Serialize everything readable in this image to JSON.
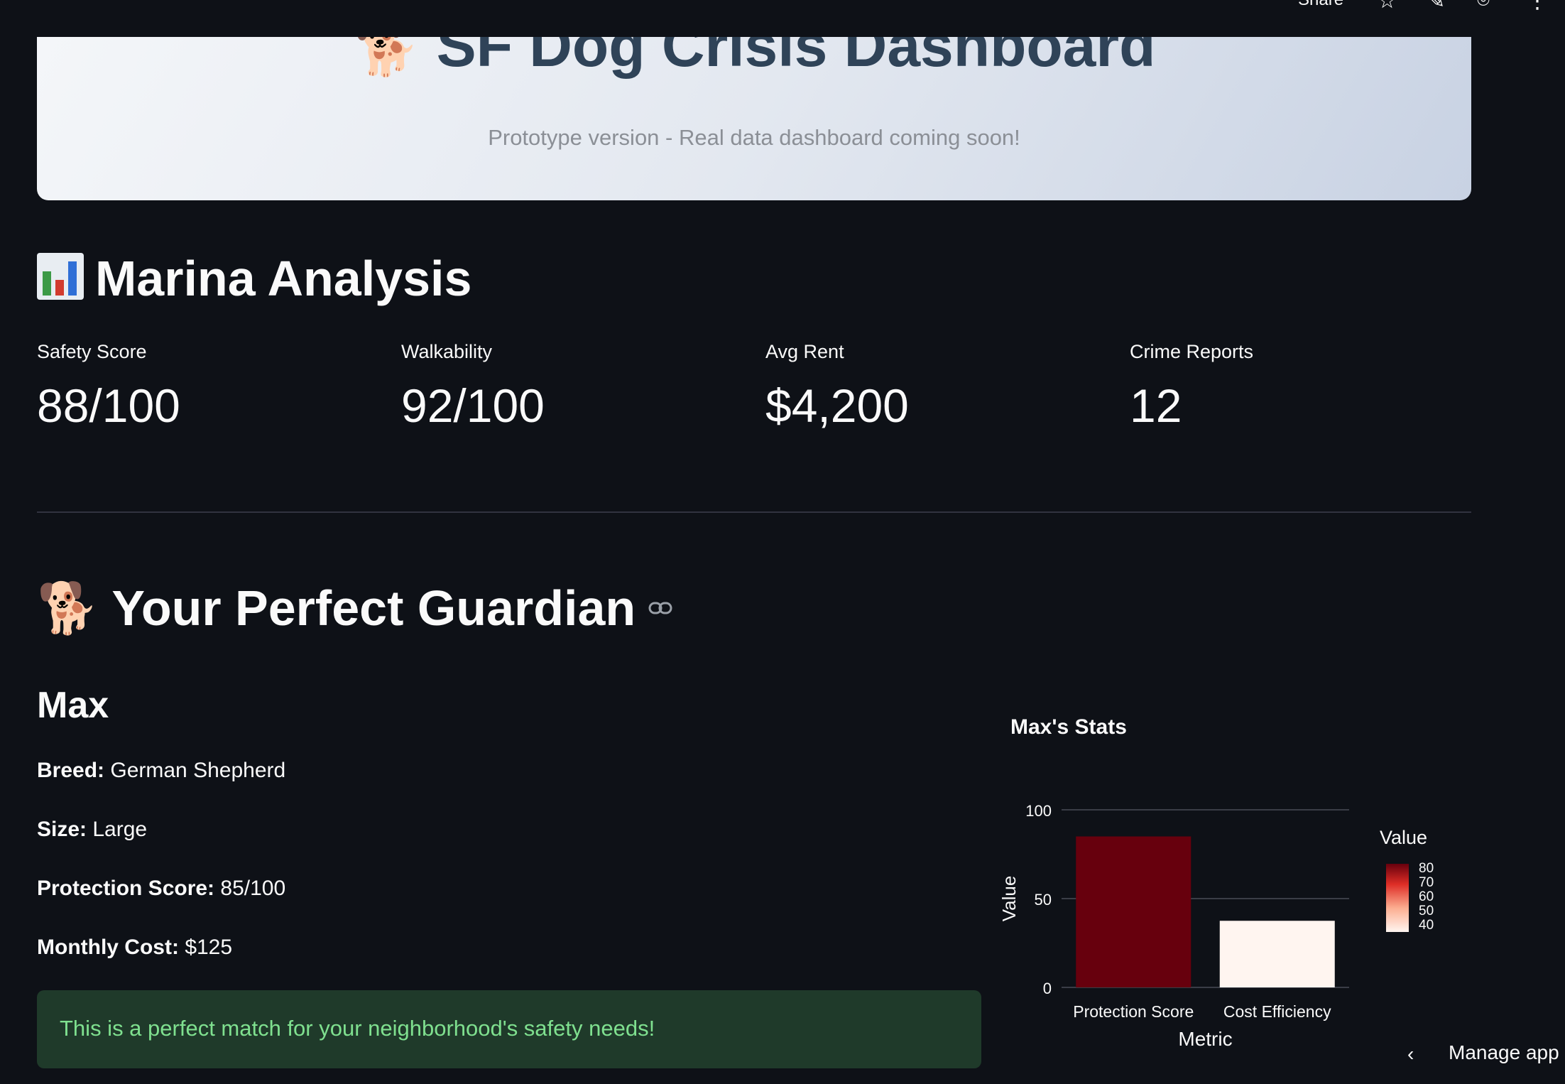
{
  "toolbar": {
    "share_label": "Share",
    "icons": [
      "star-icon",
      "edit-icon",
      "github-icon",
      "more-icon"
    ]
  },
  "hero": {
    "emoji": "🐕",
    "title": "SF Dog Crisis Dashboard",
    "subtitle": "Prototype version - Real data dashboard coming soon!"
  },
  "analysis": {
    "title": "Marina Analysis",
    "metrics": [
      {
        "label": "Safety Score",
        "value": "88/100"
      },
      {
        "label": "Walkability",
        "value": "92/100"
      },
      {
        "label": "Avg Rent",
        "value": "$4,200"
      },
      {
        "label": "Crime Reports",
        "value": "12"
      }
    ]
  },
  "guardian": {
    "emoji": "🐕",
    "title": "Your Perfect Guardian",
    "name": "Max",
    "fields": [
      {
        "label": "Breed:",
        "value": "German Shepherd"
      },
      {
        "label": "Size:",
        "value": "Large"
      },
      {
        "label": "Protection Score:",
        "value": "85/100"
      },
      {
        "label": "Monthly Cost:",
        "value": "$125"
      }
    ],
    "success_message": "This is a perfect match for your neighborhood's safety needs!"
  },
  "stats_chart_title": "Max's Stats",
  "chart_data": {
    "type": "bar",
    "title": "Max's Stats",
    "categories": [
      "Protection Score",
      "Cost Efficiency"
    ],
    "values": [
      85,
      37.5
    ],
    "xlabel": "Metric",
    "ylabel": "Value",
    "ylim": [
      0,
      100
    ],
    "yticks": [
      0,
      50,
      100
    ],
    "grid": true,
    "colorscale": "Reds",
    "legend": {
      "title": "Value",
      "ticks": [
        80,
        70,
        60,
        50,
        40
      ],
      "placement": "right"
    }
  },
  "footer": {
    "manage_label": "Manage app"
  }
}
